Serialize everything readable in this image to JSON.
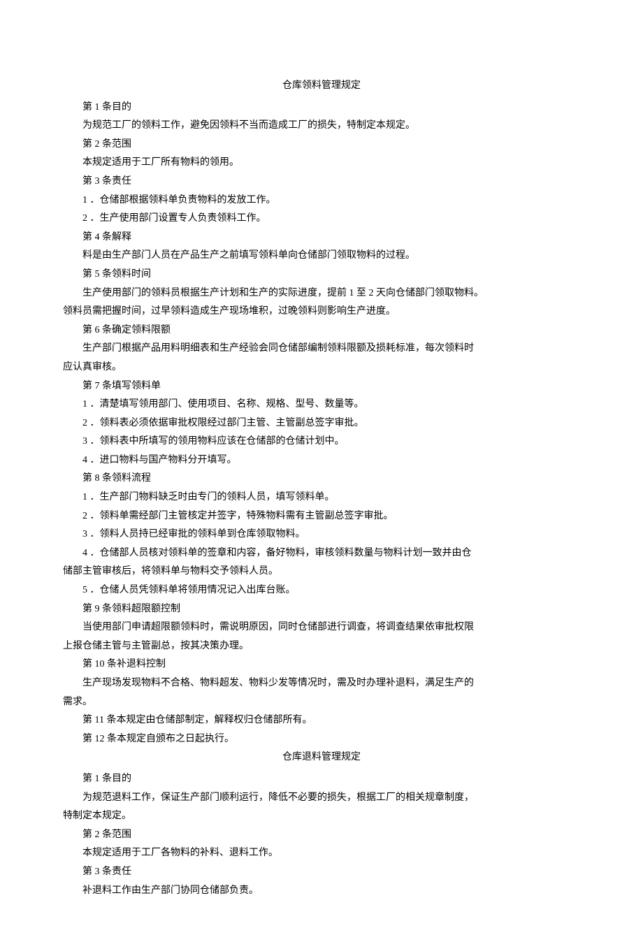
{
  "doc1": {
    "title": "仓库领料管理规定",
    "a1_heading": "第 1 条目的",
    "a1_p1": "为规范工厂的领料工作，避免因领料不当而造成工厂的损失，特制定本规定。",
    "a2_heading": "第 2 条范围",
    "a2_p1": "本规定适用于工厂所有物料的领用。",
    "a3_heading": "第 3 条责任",
    "a3_i1": "1 ．仓储部根据领料单负责物料的发放工作。",
    "a3_i2": "2 ．生产使用部门设置专人负责领料工作。",
    "a4_heading": "第 4 条解释",
    "a4_p1": "料是由生产部门人员在产品生产之前填写领料单向仓储部门领取物料的过程。",
    "a5_heading": "第 5 条领料时间",
    "a5_p1": "生产使用部门的领料员根据生产计划和生产的实际进度，提前 1 至 2 天向仓储部门领取物料。",
    "a5_p2": "领料员需把握时间，过早领料造成生产现场堆积，过晚领料则影响生产进度。",
    "a6_heading": "第 6 条确定领料限额",
    "a6_p1": "生产部门根据产品用料明细表和生产经验会同仓储部编制领料限额及损耗标准，每次领料时",
    "a6_p2": "应认真审核。",
    "a7_heading": "第 7 条填写领料单",
    "a7_i1": "1 ．清楚填写领用部门、使用项目、名称、规格、型号、数量等。",
    "a7_i2": "2 ．领料表必须依据审批权限经过部门主管、主管副总签字审批。",
    "a7_i3": "3 ．领料表中所填写的领用物料应该在仓储部的仓储计划中。",
    "a7_i4": "4 ．进口物料与国产物料分开填写。",
    "a8_heading": "第 8 条领料流程",
    "a8_i1": "1 ．生产部门物料缺乏时由专门的领料人员，填写领料单。",
    "a8_i2": "2 ．领料单需经部门主管核定并签字，特殊物料需有主管副总签字审批。",
    "a8_i3": "3 ．领料人员持已经审批的领料单到仓库领取物料。",
    "a8_i4a": "4 ．仓储部人员核对领料单的签章和内容，备好物料，审核领料数量与物料计划一致并由仓",
    "a8_i4b": "储部主管审核后，将领料单与物料交予领料人员。",
    "a8_i5": "5 ．仓储人员凭领料单将领用情况记入出库台账。",
    "a9_heading": "第 9 条领料超限额控制",
    "a9_p1": "当使用部门申请超限额领料时，需说明原因，同时仓储部进行调查，将调查结果依审批权限",
    "a9_p2": "上报仓储主管与主管副总，按其决策办理。",
    "a10_heading": "第 10 条补退料控制",
    "a10_p1": "生产现场发现物料不合格、物料超发、物料少发等情况时，需及时办理补退料，满足生产的",
    "a10_p2": "需求。",
    "a11": "第 11 条本规定由仓储部制定，解释权归仓储部所有。",
    "a12": "第 12 条本规定自颁布之日起执行。"
  },
  "doc2": {
    "title": "仓库退料管理规定",
    "a1_heading": "第 1 条目的",
    "a1_p1": "为规范退料工作，保证生产部门顺利运行，降低不必要的损失，根据工厂的相关规章制度，",
    "a1_p2": "特制定本规定。",
    "a2_heading": "第 2 条范围",
    "a2_p1": "本规定适用于工厂各物料的补料、退料工作。",
    "a3_heading": "第 3 条责任",
    "a3_p1": "补退料工作由生产部门协同仓储部负责。"
  }
}
